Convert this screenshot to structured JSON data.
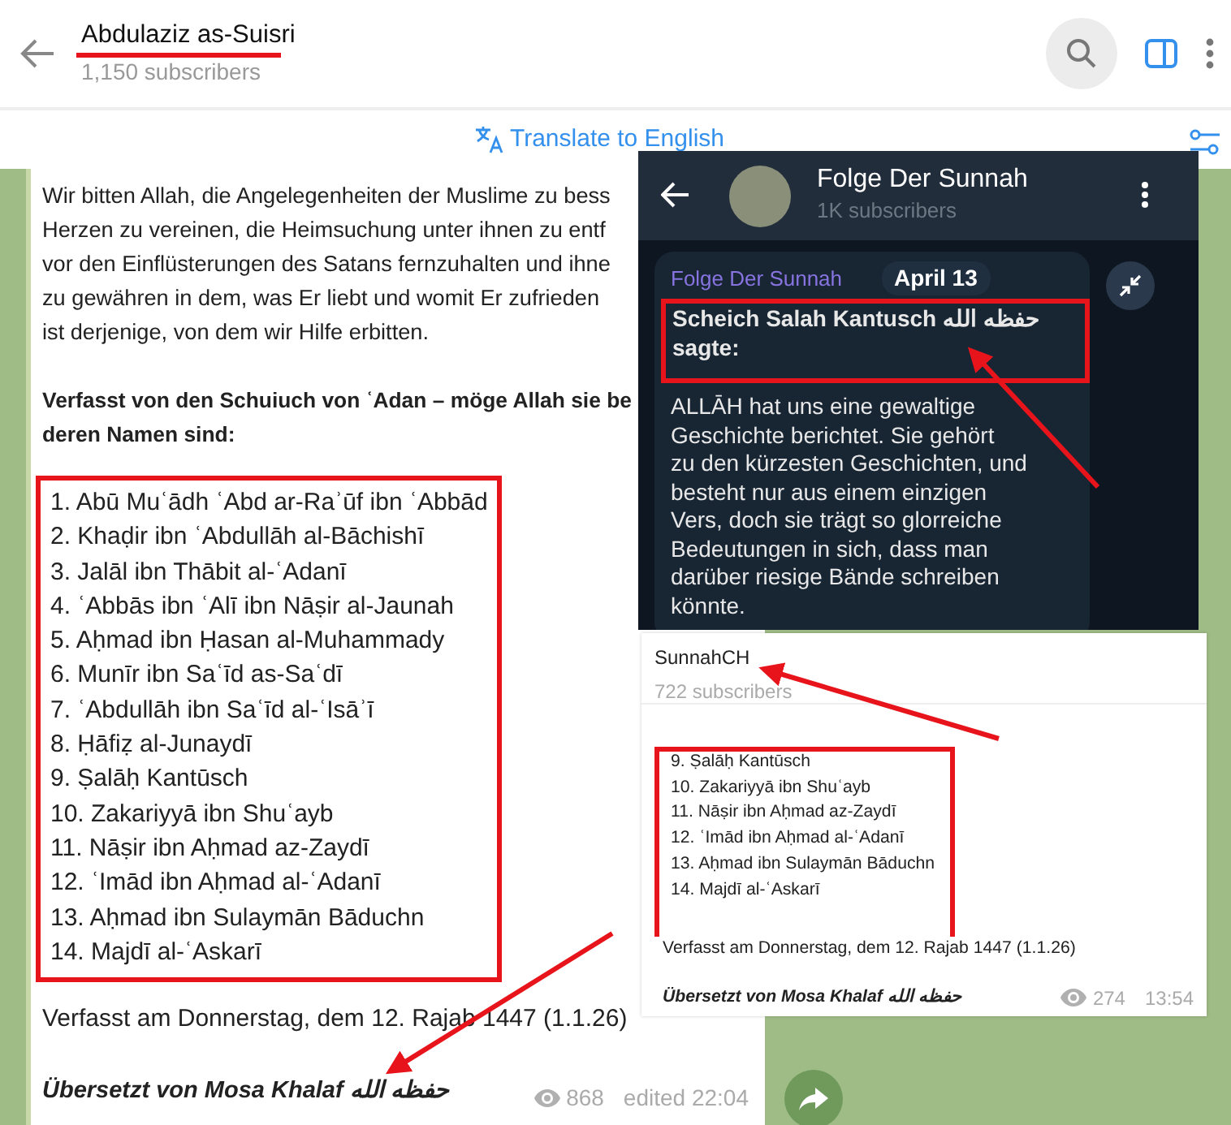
{
  "header": {
    "title": "Abdulaziz as-Suisri",
    "subtitle": "1,150 subscribers"
  },
  "translate_bar": {
    "label": "Translate to English"
  },
  "message": {
    "paragraph_lines": [
      "Wir bitten Allah, die Angelegenheiten der Muslime zu bess",
      "Herzen zu vereinen, die Heimsuchung unter ihnen zu entf",
      "vor den Einflüsterungen des Satans fernzuhalten und ihne",
      "zu gewähren in dem, was Er liebt und womit Er zufrieden",
      "ist derjenige, von dem wir Hilfe erbitten."
    ],
    "heading_lines": [
      "Verfasst von den Schuiuch von ʿAdan – möge Allah sie be",
      "deren Namen sind:"
    ],
    "names": [
      "1. Abū Muʿādh ʿAbd ar-Raʾūf ibn ʿAbbād",
      "2. Khaḍir ibn ʿAbdullāh al-Bāchishī",
      "3. Jalāl ibn Thābit al-ʿAdanī",
      "4. ʿAbbās ibn ʿAlī ibn Nāṣir al-Jaunah",
      "5. Aḥmad ibn Ḥasan al-Muhammady",
      "6. Munīr ibn Saʿīd as-Saʿdī",
      "7. ʿAbdullāh ibn Saʿīd al-ʿIsāʾī",
      "8. Ḥāfiẓ al-Junaydī",
      "9. Ṣalāḥ Kantūsch",
      "10. Zakariyyā ibn Shuʿayb",
      "11. Nāṣir ibn Aḥmad az-Zaydī",
      "12. ʿImād ibn Aḥmad al-ʿAdanī",
      "13. Aḥmad ibn Sulaymān Bāduchn",
      "14. Majdī al-ʿAskarī"
    ],
    "date_line": "Verfasst am Donnerstag, dem 12. Rajab 1447 (1.1.26)",
    "signature": "Übersetzt von Mosa Khalaf حفظه الله",
    "views": "868",
    "edited": "edited 22:04"
  },
  "inset_dark": {
    "title": "Folge Der Sunnah",
    "subtitle": "1K subscribers",
    "sender": "Folge Der Sunnah",
    "date": "April 13",
    "heading_lines": [
      "Scheich Salah Kantusch حفظه الله",
      "sagte:"
    ],
    "body_lines": [
      "ALLĀH hat uns eine gewaltige",
      "Geschichte berichtet. Sie gehört",
      "zu den kürzesten Geschichten, und",
      "besteht nur aus einem einzigen",
      "Vers, doch sie trägt so glorreiche",
      "Bedeutungen in sich, dass man",
      "darüber riesige Bände schreiben",
      "könnte."
    ]
  },
  "inset_light": {
    "title": "SunnahCH",
    "subtitle": "722 subscribers",
    "names": [
      "9. Ṣalāḥ Kantūsch",
      "10. Zakariyyā ibn Shuʿayb",
      "11. Nāṣir ibn Aḥmad az-Zaydī",
      "12. ʿImād ibn Aḥmad al-ʿAdanī",
      "13. Aḥmad ibn Sulaymān Bāduchn",
      "14. Majdī al-ʿAskarī"
    ],
    "date_line": "Verfasst am Donnerstag, dem 12. Rajab 1447 (1.1.26)",
    "signature": "Übersetzt von Mosa Khalaf حفظه الله",
    "views": "274",
    "time": "13:54"
  }
}
